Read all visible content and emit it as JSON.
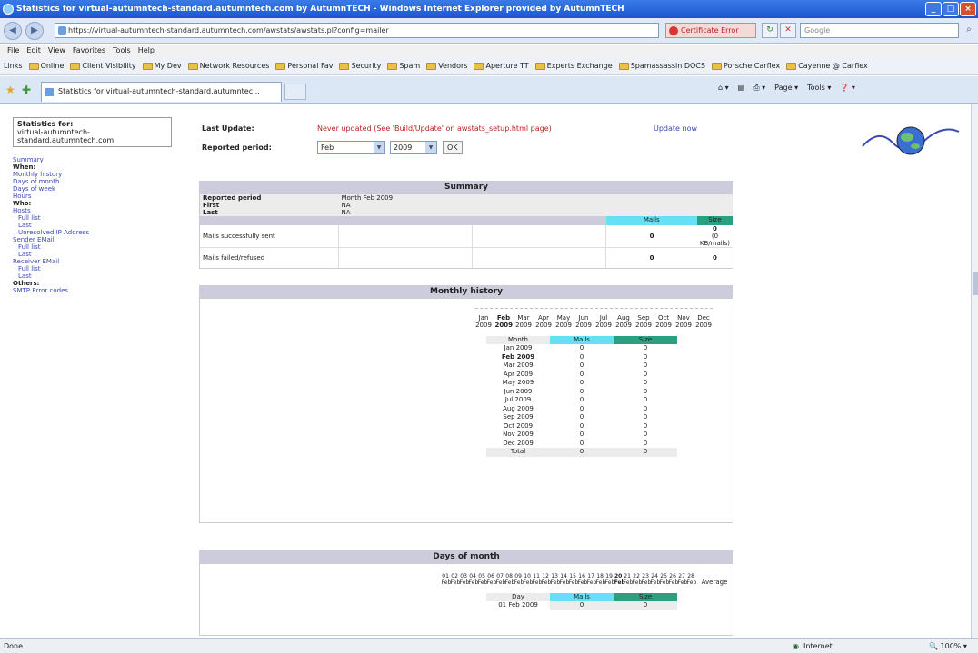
{
  "window": {
    "title": "Statistics for virtual-autumntech-standard.autumntech.com by AutumnTECH - Windows Internet Explorer provided by AutumnTECH",
    "buttons": [
      "_",
      "□",
      "×"
    ]
  },
  "address": {
    "url": "https://virtual-autumntech-standard.autumntech.com/awstats/awstats.pl?config=mailer",
    "cert_error": "Certificate Error",
    "search_placeholder": "Google"
  },
  "menubar": [
    "File",
    "Edit",
    "View",
    "Favorites",
    "Tools",
    "Help"
  ],
  "favorites": {
    "label": "Links",
    "items": [
      "Online",
      "Client Visibility",
      "My Dev",
      "Network Resources",
      "Personal Fav",
      "Security",
      "Spam",
      "Vendors",
      "Aperture TT",
      "Experts Exchange",
      "Spamassassin DOCS",
      "Porsche Carflex",
      "Cayenne @ Carflex"
    ]
  },
  "tab": {
    "title": "Statistics for virtual-autumntech-standard.autumntec..."
  },
  "commandbar": [
    "Page",
    "Tools"
  ],
  "sidebar": {
    "stats_for": "Statistics for:",
    "host_line1": "virtual-autumntech-",
    "host_line2": "standard.autumntech.com",
    "summary": "Summary",
    "when": "When:",
    "monthly_history": "Monthly history",
    "days_of_month": "Days of month",
    "days_of_week": "Days of week",
    "hours": "Hours",
    "who": "Who:",
    "hosts": "Hosts",
    "full_list": "Full list",
    "last": "Last",
    "unresolved": "Unresolved IP Address",
    "sender": "Sender EMail",
    "receiver": "Receiver EMail",
    "others": "Others:",
    "smtp": "SMTP Error codes"
  },
  "update": {
    "last_update_label": "Last Update:",
    "last_update_value": "Never updated (See 'Build/Update' on awstats_setup.html page)",
    "update_now": "Update now",
    "reported_period_label": "Reported period:",
    "month_value": "Feb",
    "year_value": "2009",
    "ok": "OK"
  },
  "summary": {
    "title": "Summary",
    "reported_period": "Reported period",
    "reported_value": "Month Feb 2009",
    "first": "First",
    "first_value": "NA",
    "last": "Last",
    "last_value": "NA",
    "mails_col": "Mails",
    "size_col": "Size",
    "sent_label": "Mails successfully sent",
    "sent_mails": "0",
    "sent_size": "0",
    "sent_size_sub": "(0 KB/mails)",
    "failed_label": "Mails failed/refused",
    "failed_mails": "0",
    "failed_size": "0"
  },
  "monthly": {
    "title": "Monthly history",
    "months": [
      "Jan",
      "Feb",
      "Mar",
      "Apr",
      "May",
      "Jun",
      "Jul",
      "Aug",
      "Sep",
      "Oct",
      "Nov",
      "Dec"
    ],
    "year": "2009",
    "col_month": "Month",
    "col_mails": "Mails",
    "col_size": "Size",
    "rows": [
      [
        "Jan 2009",
        "0",
        "0"
      ],
      [
        "Feb 2009",
        "0",
        "0"
      ],
      [
        "Mar 2009",
        "0",
        "0"
      ],
      [
        "Apr 2009",
        "0",
        "0"
      ],
      [
        "May 2009",
        "0",
        "0"
      ],
      [
        "Jun 2009",
        "0",
        "0"
      ],
      [
        "Jul 2009",
        "0",
        "0"
      ],
      [
        "Aug 2009",
        "0",
        "0"
      ],
      [
        "Sep 2009",
        "0",
        "0"
      ],
      [
        "Oct 2009",
        "0",
        "0"
      ],
      [
        "Nov 2009",
        "0",
        "0"
      ],
      [
        "Dec 2009",
        "0",
        "0"
      ]
    ],
    "total_label": "Total",
    "total_mails": "0",
    "total_size": "0"
  },
  "days": {
    "title": "Days of month",
    "days": [
      "01",
      "02",
      "03",
      "04",
      "05",
      "06",
      "07",
      "08",
      "09",
      "10",
      "11",
      "12",
      "13",
      "14",
      "15",
      "16",
      "17",
      "18",
      "19",
      "20",
      "21",
      "22",
      "23",
      "24",
      "25",
      "26",
      "27",
      "28"
    ],
    "month": "Feb",
    "average": "Average",
    "col_day": "Day",
    "col_mails": "Mails",
    "col_size": "Size",
    "first_row": [
      "01 Feb 2009",
      "0",
      "0"
    ]
  },
  "status": {
    "left": "Done",
    "zone": "Internet",
    "zoom": "100%"
  },
  "colors": {
    "mails": "#66e0f5",
    "size": "#2aa081",
    "section_header": "#ccccdd",
    "alert_red": "#b22222"
  }
}
